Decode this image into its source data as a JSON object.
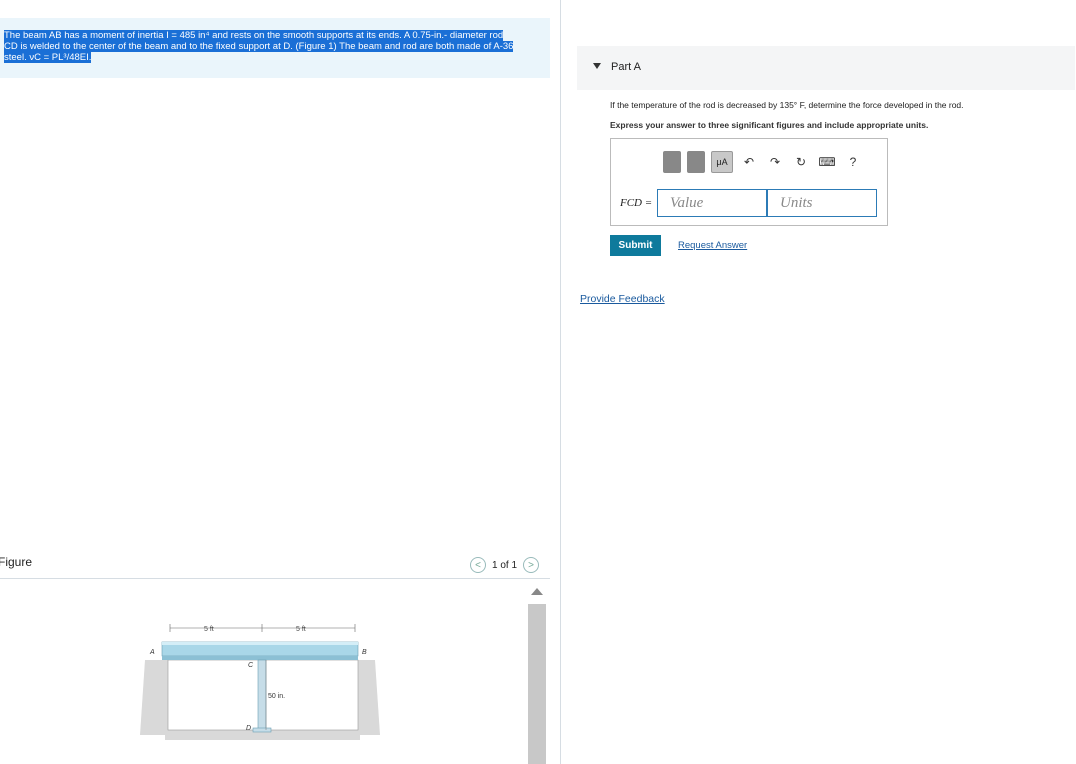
{
  "problem": {
    "line1": "The beam AB has a moment of inertia I = 485 in⁴ and rests on the smooth supports at its ends. A 0.75-in.- diameter rod",
    "line2": "CD is welded to the center of the beam and to the fixed support at D. (Figure 1) The beam and rod are both made of A-36",
    "line3": "steel. νC = PL³/48EI."
  },
  "figure": {
    "label": "Figure",
    "pager": "1 of 1",
    "dim_left": "5 ft",
    "dim_right": "5 ft",
    "label_a": "A",
    "label_b": "B",
    "label_c": "C",
    "label_d": "D",
    "rod_length": "50 in."
  },
  "part": {
    "title": "Part A",
    "question": "If the temperature of the rod is decreased by 135° F, determine the force developed in the rod.",
    "instruction": "Express your answer to three significant figures and include appropriate units.",
    "toolbar_mu": "μA",
    "symbol": "FCD =",
    "value_placeholder": "Value",
    "units_placeholder": "Units",
    "submit": "Submit",
    "request": "Request Answer"
  },
  "feedback": "Provide Feedback",
  "colors": {
    "accent": "#0e7a9c",
    "link": "#1a5a9e",
    "highlight": "#1a6fd6"
  }
}
